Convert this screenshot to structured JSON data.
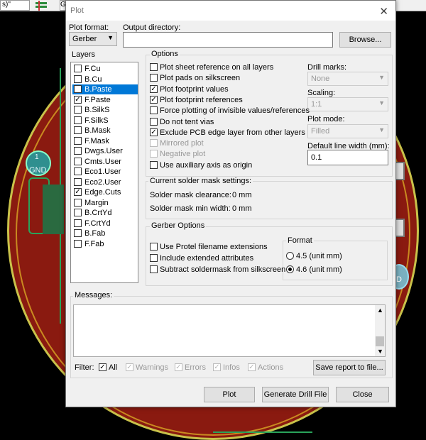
{
  "background": {
    "toolbar_combo": "s)\"",
    "toolbar_g": "G",
    "pad_number": "1",
    "pad_label": "GND",
    "right_pad_label": "D"
  },
  "dialog": {
    "title": "Plot",
    "plot_format_label": "Plot format:",
    "plot_format_value": "Gerber",
    "output_dir_label": "Output directory:",
    "output_dir_value": "",
    "browse_label": "Browse...",
    "layers_title": "Layers",
    "layers": [
      {
        "name": "F.Cu",
        "checked": false,
        "selected": false
      },
      {
        "name": "B.Cu",
        "checked": false,
        "selected": false
      },
      {
        "name": "B.Paste",
        "checked": true,
        "selected": true
      },
      {
        "name": "F.Paste",
        "checked": true,
        "selected": false
      },
      {
        "name": "B.SilkS",
        "checked": false,
        "selected": false
      },
      {
        "name": "F.SilkS",
        "checked": false,
        "selected": false
      },
      {
        "name": "B.Mask",
        "checked": false,
        "selected": false
      },
      {
        "name": "F.Mask",
        "checked": false,
        "selected": false
      },
      {
        "name": "Dwgs.User",
        "checked": false,
        "selected": false
      },
      {
        "name": "Cmts.User",
        "checked": false,
        "selected": false
      },
      {
        "name": "Eco1.User",
        "checked": false,
        "selected": false
      },
      {
        "name": "Eco2.User",
        "checked": false,
        "selected": false
      },
      {
        "name": "Edge.Cuts",
        "checked": true,
        "selected": false
      },
      {
        "name": "Margin",
        "checked": false,
        "selected": false
      },
      {
        "name": "B.CrtYd",
        "checked": false,
        "selected": false
      },
      {
        "name": "F.CrtYd",
        "checked": false,
        "selected": false
      },
      {
        "name": "B.Fab",
        "checked": false,
        "selected": false
      },
      {
        "name": "F.Fab",
        "checked": false,
        "selected": false
      }
    ],
    "options_title": "Options",
    "options": [
      {
        "label": "Plot sheet reference on all layers",
        "checked": false,
        "disabled": false
      },
      {
        "label": "Plot pads on silkscreen",
        "checked": false,
        "disabled": false
      },
      {
        "label": "Plot footprint values",
        "checked": true,
        "disabled": false
      },
      {
        "label": "Plot footprint references",
        "checked": true,
        "disabled": false
      },
      {
        "label": "Force plotting of invisible values/references",
        "checked": false,
        "disabled": false
      },
      {
        "label": "Do not tent vias",
        "checked": false,
        "disabled": false
      },
      {
        "label": "Exclude PCB edge layer from other layers",
        "checked": true,
        "disabled": false
      },
      {
        "label": "Mirrored plot",
        "checked": false,
        "disabled": true
      },
      {
        "label": "Negative plot",
        "checked": false,
        "disabled": true
      },
      {
        "label": "Use auxiliary axis as origin",
        "checked": false,
        "disabled": false
      }
    ],
    "drill_marks_label": "Drill marks:",
    "drill_marks_value": "None",
    "scaling_label": "Scaling:",
    "scaling_value": "1:1",
    "plot_mode_label": "Plot mode:",
    "plot_mode_value": "Filled",
    "line_width_label": "Default line width (mm):",
    "line_width_value": "0.1",
    "solder_title": "Current solder mask settings:",
    "solder_clearance_label": "Solder mask clearance:",
    "solder_clearance_value": "0 mm",
    "solder_min_width_label": "Solder mask min width:",
    "solder_min_width_value": "0 mm",
    "gerber_title": "Gerber Options",
    "gerber_options": [
      {
        "label": "Use Protel filename extensions",
        "checked": false
      },
      {
        "label": "Include extended attributes",
        "checked": false
      },
      {
        "label": "Subtract soldermask from silkscreen",
        "checked": false
      }
    ],
    "format_title": "Format",
    "format_options": [
      {
        "label": "4.5 (unit mm)",
        "selected": false
      },
      {
        "label": "4.6 (unit mm)",
        "selected": true
      }
    ],
    "messages_title": "Messages:",
    "filter_label": "Filter:",
    "filters": [
      {
        "label": "All",
        "checked": true,
        "disabled": false
      },
      {
        "label": "Warnings",
        "checked": true,
        "disabled": true
      },
      {
        "label": "Errors",
        "checked": true,
        "disabled": true
      },
      {
        "label": "Infos",
        "checked": true,
        "disabled": true
      },
      {
        "label": "Actions",
        "checked": true,
        "disabled": true
      }
    ],
    "save_report_label": "Save report to file...",
    "plot_button": "Plot",
    "drill_button": "Generate Drill File",
    "close_button": "Close"
  }
}
